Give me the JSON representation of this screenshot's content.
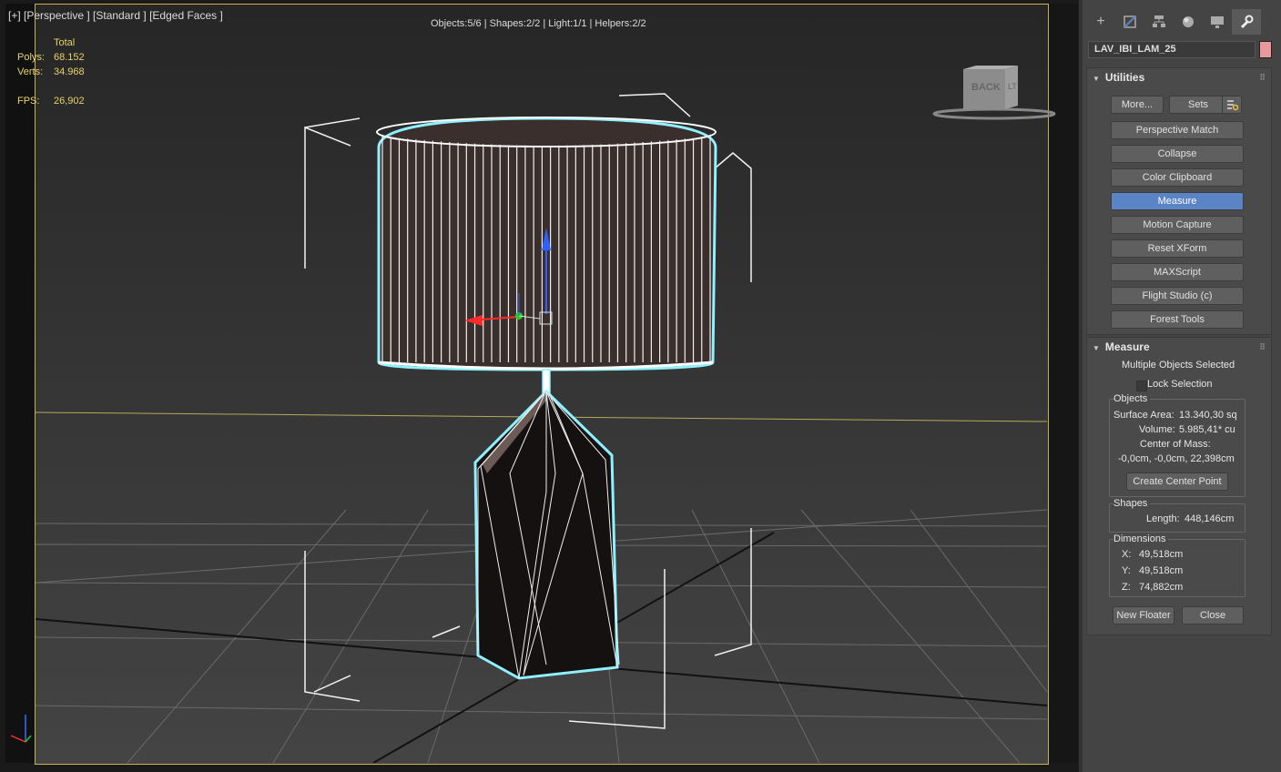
{
  "viewport": {
    "label": "[+] [Perspective ] [Standard ] [Edged Faces ]",
    "scene_stats": "Objects:5/6 | Shapes:2/2 | Light:1/1 | Helpers:2/2",
    "stats": {
      "total_header": "Total",
      "polys_label": "Polys:",
      "polys_value": "68.152",
      "verts_label": "Verts:",
      "verts_value": "34.968",
      "fps_label": "FPS:",
      "fps_value": "26,902"
    },
    "viewcube_face": "BACK",
    "viewcube_side": "LT"
  },
  "panel": {
    "tabs": [
      "create-icon",
      "modify-icon",
      "hierarchy-icon",
      "motion-icon",
      "display-icon",
      "utilities-icon"
    ],
    "object_name": "LAV_IBI_LAM_25",
    "object_color": "#e89a9a",
    "utilities": {
      "title": "Utilities",
      "more": "More...",
      "sets": "Sets",
      "items": [
        "Perspective Match",
        "Collapse",
        "Color Clipboard",
        "Measure",
        "Motion Capture",
        "Reset XForm",
        "MAXScript",
        "Flight Studio (c)",
        "Forest Tools"
      ],
      "selected": "Measure"
    },
    "measure": {
      "title": "Measure",
      "status": "Multiple Objects Selected",
      "lock_selection": "Lock Selection",
      "objects_title": "Objects",
      "surface_area_label": "Surface Area:",
      "surface_area_value": "13.340,30 sq",
      "volume_label": "Volume:",
      "volume_value": "5.985,41* cu",
      "center_of_mass_label": "Center of Mass:",
      "center_of_mass_value": "-0,0cm, -0,0cm, 22,398cm",
      "create_center_point": "Create Center Point",
      "shapes_title": "Shapes",
      "length_label": "Length:",
      "length_value": "448,146cm",
      "dimensions_title": "Dimensions",
      "x_label": "X:",
      "x_value": "49,518cm",
      "y_label": "Y:",
      "y_value": "49,518cm",
      "z_label": "Z:",
      "z_value": "74,882cm",
      "new_floater": "New Floater",
      "close": "Close"
    }
  }
}
